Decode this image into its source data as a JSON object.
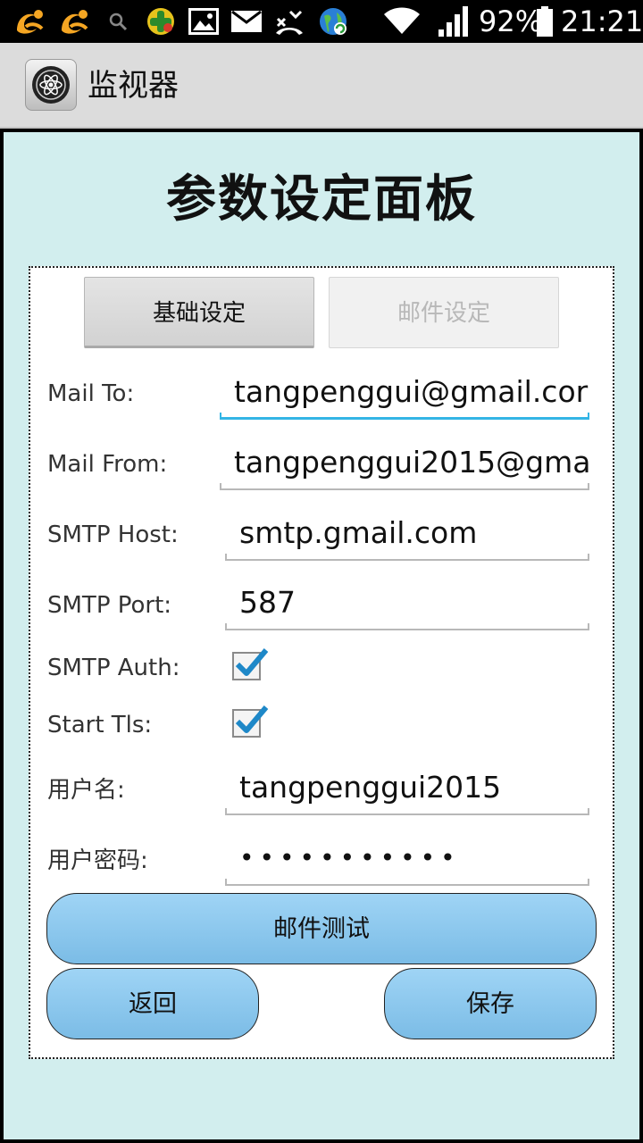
{
  "status_bar": {
    "battery": "92%",
    "time": "21:21",
    "icons": [
      "uc-browser-icon",
      "uc-browser-icon",
      "search-icon",
      "game-app-icon",
      "gallery-icon",
      "mail-icon",
      "missed-call-icon",
      "globe-app-icon",
      "wifi-icon",
      "signal-icon",
      "battery-icon"
    ]
  },
  "action_bar": {
    "title": "监视器"
  },
  "page": {
    "title": "参数设定面板"
  },
  "tabs": [
    {
      "label": "基础设定",
      "active": true
    },
    {
      "label": "邮件设定",
      "active": false
    }
  ],
  "form": {
    "mail_to": {
      "label": "Mail To:",
      "value": "tangpenggui@gmail.cor"
    },
    "mail_from": {
      "label": "Mail From:",
      "value": "tangpenggui2015@gma"
    },
    "smtp_host": {
      "label": "SMTP Host:",
      "value": "smtp.gmail.com"
    },
    "smtp_port": {
      "label": "SMTP Port:",
      "value": "587"
    },
    "smtp_auth": {
      "label": "SMTP Auth:",
      "checked": true
    },
    "start_tls": {
      "label": "Start Tls:",
      "checked": true
    },
    "username": {
      "label": "用户名:",
      "value": "tangpenggui2015"
    },
    "password": {
      "label": "用户密码:",
      "value": "•••••••••••"
    }
  },
  "buttons": {
    "test_mail": "邮件测试",
    "back": "返回",
    "save": "保存"
  },
  "colors": {
    "panel_bg": "#d2eeee",
    "button_blue": "#8cc8ee",
    "focus_accent": "#33b5e5",
    "checkmark": "#1e88c8"
  }
}
